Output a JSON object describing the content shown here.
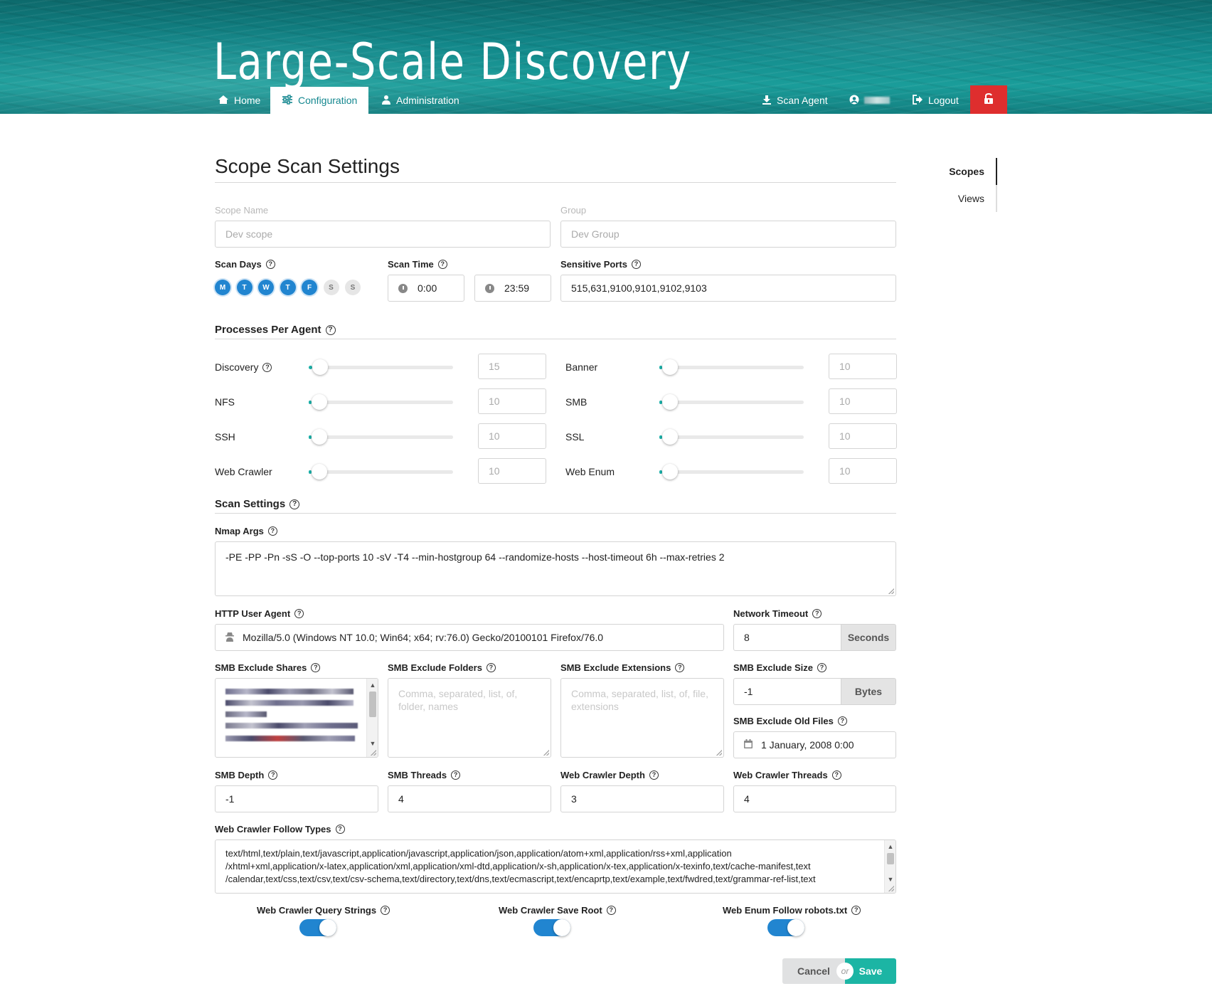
{
  "header": {
    "app_title": "Large-Scale Discovery",
    "nav": [
      {
        "label": "Home",
        "icon": "home-icon"
      },
      {
        "label": "Configuration",
        "icon": "sliders-icon"
      },
      {
        "label": "Administration",
        "icon": "user-tie-icon"
      }
    ],
    "right_nav": [
      {
        "label": "Scan Agent",
        "icon": "download-icon"
      },
      {
        "label": "",
        "icon": "user-circle-icon"
      },
      {
        "label": "Logout",
        "icon": "sign-out-icon"
      }
    ],
    "lock_icon": "unlock-icon",
    "colors": {
      "accent": "#14878f",
      "lock_bg": "#de2e2e"
    }
  },
  "side_nav": {
    "items": [
      "Scopes",
      "Views"
    ],
    "active": "Scopes"
  },
  "form": {
    "title": "Scope Scan Settings",
    "scope_name": {
      "label": "Scope Name",
      "value": "Dev scope"
    },
    "group": {
      "label": "Group",
      "value": "Dev Group"
    },
    "scan_days": {
      "label": "Scan Days",
      "days": [
        "M",
        "T",
        "W",
        "T",
        "F",
        "S",
        "S"
      ],
      "active": [
        true,
        true,
        true,
        true,
        true,
        false,
        false
      ]
    },
    "scan_time": {
      "label": "Scan Time",
      "start": "0:00",
      "end": "23:59"
    },
    "sensitive_ports": {
      "label": "Sensitive Ports",
      "value": "515,631,9100,9101,9102,9103"
    },
    "processes": {
      "section": "Processes Per Agent",
      "items": [
        {
          "name": "Discovery",
          "value": "15"
        },
        {
          "name": "Banner",
          "value": "10"
        },
        {
          "name": "NFS",
          "value": "10"
        },
        {
          "name": "SMB",
          "value": "10"
        },
        {
          "name": "SSH",
          "value": "10"
        },
        {
          "name": "SSL",
          "value": "10"
        },
        {
          "name": "Web Crawler",
          "value": "10"
        },
        {
          "name": "Web Enum",
          "value": "10"
        }
      ]
    },
    "scan_settings": {
      "section": "Scan Settings",
      "nmap_args": {
        "label": "Nmap Args",
        "value": "-PE -PP -Pn -sS -O --top-ports 10 -sV -T4 --min-hostgroup 64 --randomize-hosts --host-timeout 6h --max-retries 2"
      },
      "http_user_agent": {
        "label": "HTTP User Agent",
        "value": "Mozilla/5.0 (Windows NT 10.0; Win64; x64; rv:76.0) Gecko/20100101 Firefox/76.0"
      },
      "network_timeout": {
        "label": "Network Timeout",
        "value": "8",
        "unit": "Seconds"
      },
      "smb_exclude_shares": {
        "label": "SMB Exclude Shares"
      },
      "smb_exclude_folders": {
        "label": "SMB Exclude Folders",
        "placeholder": "Comma, separated, list, of, folder, names"
      },
      "smb_exclude_extensions": {
        "label": "SMB Exclude Extensions",
        "placeholder": "Comma, separated, list, of, file, extensions"
      },
      "smb_exclude_size": {
        "label": "SMB Exclude Size",
        "value": "-1",
        "unit": "Bytes"
      },
      "smb_exclude_old_files": {
        "label": "SMB Exclude Old Files",
        "value": "1 January, 2008 0:00"
      },
      "smb_depth": {
        "label": "SMB Depth",
        "value": "-1"
      },
      "smb_threads": {
        "label": "SMB Threads",
        "value": "4"
      },
      "web_crawler_depth": {
        "label": "Web Crawler Depth",
        "value": "3"
      },
      "web_crawler_threads": {
        "label": "Web Crawler Threads",
        "value": "4"
      },
      "web_crawler_follow_types": {
        "label": "Web Crawler Follow Types",
        "lines": [
          "text/html,text/plain,text/javascript,application/javascript,application/json,application/atom+xml,application/rss+xml,application",
          "/xhtml+xml,application/x-latex,application/xml,application/xml-dtd,application/x-sh,application/x-tex,application/x-texinfo,text/cache-manifest,text",
          "/calendar,text/css,text/csv,text/csv-schema,text/directory,text/dns,text/ecmascript,text/encaprtp,text/example,text/fwdred,text/grammar-ref-list,text"
        ]
      },
      "toggles": [
        {
          "label": "Web Crawler Query Strings",
          "on": true
        },
        {
          "label": "Web Crawler Save Root",
          "on": true
        },
        {
          "label": "Web Enum Follow robots.txt",
          "on": true
        }
      ]
    },
    "actions": {
      "cancel": "Cancel",
      "or": "or",
      "save": "Save"
    }
  }
}
